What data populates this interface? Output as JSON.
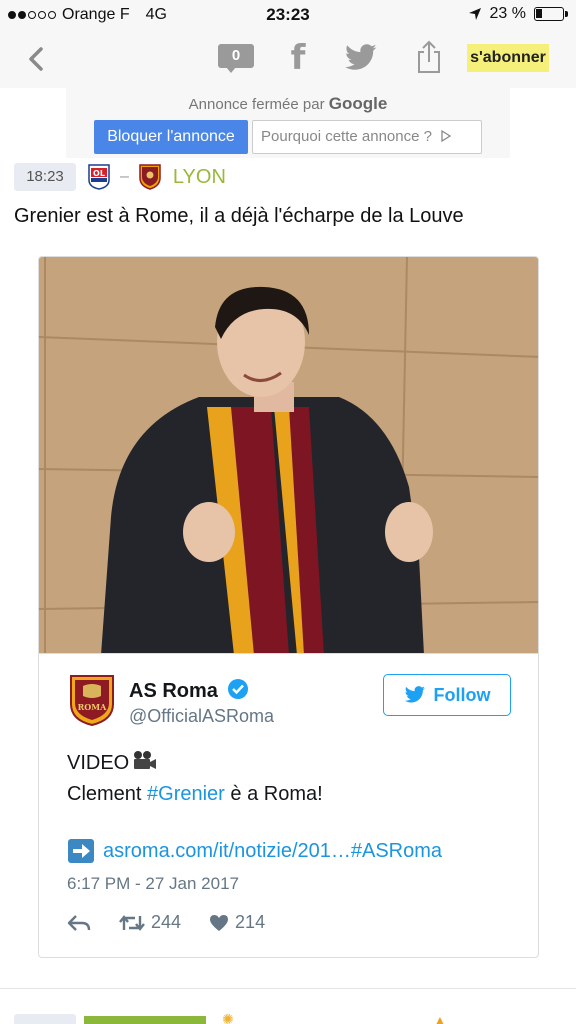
{
  "status_bar": {
    "carrier": "Orange F",
    "network": "4G",
    "time": "23:23",
    "battery": "23 %",
    "battery_level": 0.23
  },
  "nav": {
    "comment_count": "0",
    "facebook_glyph": "f",
    "subscribe_label": "s'abonner"
  },
  "ad": {
    "closed_prefix": "Annonce fermée par",
    "closed_brand": "Google",
    "block_label": "Bloquer l'annonce",
    "why_label": "Pourquoi cette annonce ?"
  },
  "entry": {
    "time": "18:23",
    "separator": "–",
    "team": "LYON",
    "title": "Grenier est à Rome, il a déjà l'écharpe de la Louve"
  },
  "tweet": {
    "name": "AS Roma",
    "handle": "@OfficialASRoma",
    "follow_label": "Follow",
    "line1": "VIDEO",
    "line2_prefix": "Clement ",
    "hashtag": "#Grenier",
    "line2_suffix": " è a Roma!",
    "link": "asroma.com/it/notizie/201…#ASRoma",
    "date": "6:17 PM - 27 Jan 2017",
    "retweets": "244",
    "likes": "214"
  },
  "colors": {
    "accent_green": "#9ab83a",
    "twitter_blue": "#1da1f2",
    "ad_blue": "#4a86e8",
    "subscribe_yellow": "#f5f07a"
  },
  "icons": {
    "back": "chevron-left-icon",
    "comment": "comment-bubble-icon",
    "facebook": "facebook-icon",
    "twitter": "twitter-bird-icon",
    "share": "share-icon",
    "location": "location-arrow-icon",
    "battery": "battery-icon",
    "video": "video-camera-icon",
    "verified": "verified-badge-icon",
    "reply": "reply-icon",
    "retweet": "retweet-icon",
    "like": "heart-icon",
    "link": "right-arrow-icon"
  }
}
